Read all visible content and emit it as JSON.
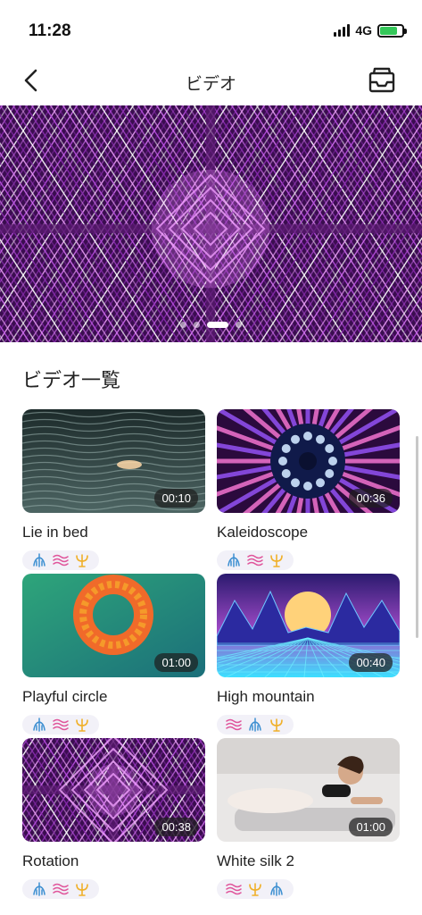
{
  "status_bar": {
    "time": "11:28",
    "network": "4G"
  },
  "header": {
    "title": "ビデオ"
  },
  "banner": {
    "slide_count": 4,
    "active_slide": 3
  },
  "section": {
    "title": "ビデオ一覧"
  },
  "videos": [
    {
      "title": "Lie in bed",
      "duration": "00:10",
      "tags": [
        "spine-icon",
        "wave-icon",
        "trident-icon"
      ]
    },
    {
      "title": "Kaleidoscope",
      "duration": "00:36",
      "tags": [
        "spine-icon",
        "wave-icon",
        "trident-icon"
      ]
    },
    {
      "title": "Playful circle",
      "duration": "01:00",
      "tags": [
        "spine-icon",
        "wave-icon",
        "trident-icon"
      ]
    },
    {
      "title": "High mountain",
      "duration": "00:40",
      "tags": [
        "wave-icon",
        "spine-icon",
        "trident-icon"
      ]
    },
    {
      "title": "Rotation",
      "duration": "00:38",
      "tags": [
        "spine-icon",
        "wave-icon",
        "trident-icon"
      ]
    },
    {
      "title": "White silk 2",
      "duration": "01:00",
      "tags": [
        "wave-icon",
        "trident-icon",
        "spine-icon"
      ]
    }
  ],
  "colors": {
    "spine": "#3d8fd1",
    "wave": "#e0559b",
    "trident": "#f0b02a",
    "accent_purple": "#a63fd0"
  }
}
